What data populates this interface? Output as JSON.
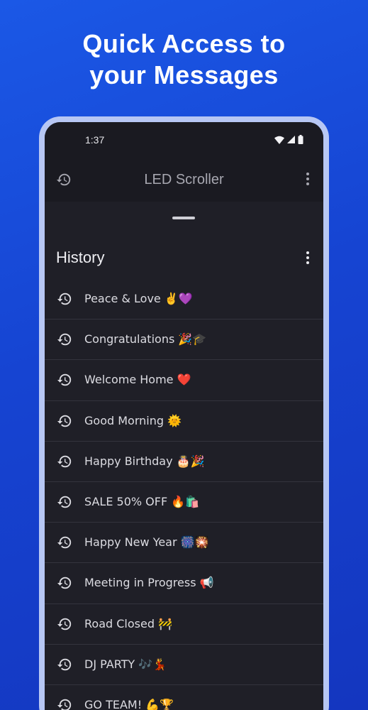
{
  "headline": {
    "line1": "Quick Access to",
    "line2": "your Messages"
  },
  "status_bar": {
    "time": "1:37",
    "icons": [
      "wifi-icon",
      "signal-icon",
      "battery-icon"
    ]
  },
  "app_bar": {
    "title": "LED Scroller",
    "left_icon": "history-icon",
    "right_icon": "more-vert-icon"
  },
  "sheet": {
    "title": "History",
    "menu_icon": "more-vert-icon",
    "items": [
      {
        "text": "Peace & Love ✌️💜"
      },
      {
        "text": "Congratulations 🎉🎓"
      },
      {
        "text": "Welcome Home ❤️"
      },
      {
        "text": "Good Morning 🌞"
      },
      {
        "text": "Happy Birthday 🎂🎉"
      },
      {
        "text": "SALE 50% OFF 🔥🛍️"
      },
      {
        "text": "Happy New Year 🎆🎇"
      },
      {
        "text": "Meeting in Progress 📢"
      },
      {
        "text": "Road Closed 🚧"
      },
      {
        "text": "DJ PARTY 🎶💃"
      },
      {
        "text": "GO TEAM! 💪🏆"
      }
    ]
  },
  "colors": {
    "background_top": "#1b58e6",
    "background_bottom": "#1436bf",
    "screen": "#1f1f27",
    "app_bar": "#1a1a21",
    "frame": "#b7c7f4",
    "divider": "#34343d"
  }
}
